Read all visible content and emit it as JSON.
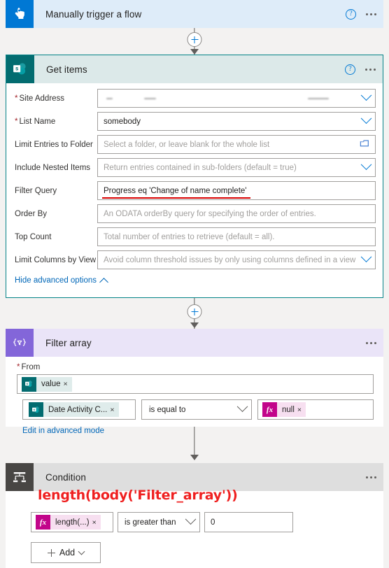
{
  "trigger": {
    "title": "Manually trigger a flow",
    "icon": "tap-hand-icon",
    "help_label": "?",
    "more_label": "...",
    "header_color": "#deecf9",
    "icon_color": "#0078d4"
  },
  "get_items": {
    "title": "Get items",
    "icon": "sharepoint-icon",
    "header_color": "#dce9e9",
    "icon_color": "#036c70",
    "border_color": "#038387",
    "fields": [
      {
        "label": "Site Address",
        "required": true,
        "value": "",
        "placeholder": "",
        "control": "dropdown",
        "redacted": true
      },
      {
        "label": "List Name",
        "required": true,
        "value": "somebody",
        "placeholder": "",
        "control": "dropdown"
      },
      {
        "label": "Limit Entries to Folder",
        "required": false,
        "value": "",
        "placeholder": "Select a folder, or leave blank for the whole list",
        "control": "folder-picker"
      },
      {
        "label": "Include Nested Items",
        "required": false,
        "value": "",
        "placeholder": "Return entries contained in sub-folders (default = true)",
        "control": "dropdown"
      },
      {
        "label": "Filter Query",
        "required": false,
        "value": "Progress eq 'Change of name complete'",
        "placeholder": "",
        "control": "text",
        "underlined": true
      },
      {
        "label": "Order By",
        "required": false,
        "value": "",
        "placeholder": "An ODATA orderBy query for specifying the order of entries.",
        "control": "text"
      },
      {
        "label": "Top Count",
        "required": false,
        "value": "",
        "placeholder": "Total number of entries to retrieve (default = all).",
        "control": "text"
      },
      {
        "label": "Limit Columns by View",
        "required": false,
        "value": "",
        "placeholder": "Avoid column threshold issues by only using columns defined in a view",
        "control": "dropdown"
      }
    ],
    "advanced_link": "Hide advanced options"
  },
  "filter_array": {
    "title": "Filter array",
    "icon": "filter-braces-icon",
    "header_color": "#eae4f8",
    "icon_color": "#8366d9",
    "from_label": "From",
    "from_required": true,
    "from_token": {
      "text": "value",
      "remove": "×",
      "source": "sharepoint"
    },
    "condition": {
      "left_token": {
        "text": "Date Activity C...",
        "remove": "×",
        "source": "sharepoint"
      },
      "operator": "is equal to",
      "right_token": {
        "text": "null",
        "remove": "×",
        "source": "expression"
      }
    },
    "advanced_mode_link": "Edit in advanced mode"
  },
  "condition": {
    "title": "Condition",
    "icon": "condition-branch-icon",
    "header_color": "#dedede",
    "icon_color": "#484644",
    "annotation": "length(body('Filter_array'))",
    "annotation_color": "#ef2020",
    "row": {
      "left_token": {
        "text": "length(...)",
        "remove": "×",
        "source": "expression"
      },
      "operator": "is greater than",
      "value": "0"
    },
    "add_button": "Add"
  },
  "connectors": [
    {
      "name": "trigger-to-getitems",
      "has_plus": true,
      "plus_label": "+"
    },
    {
      "name": "getitems-to-filter",
      "has_plus": true,
      "plus_label": "+"
    },
    {
      "name": "filter-to-condition",
      "has_plus": false
    }
  ]
}
